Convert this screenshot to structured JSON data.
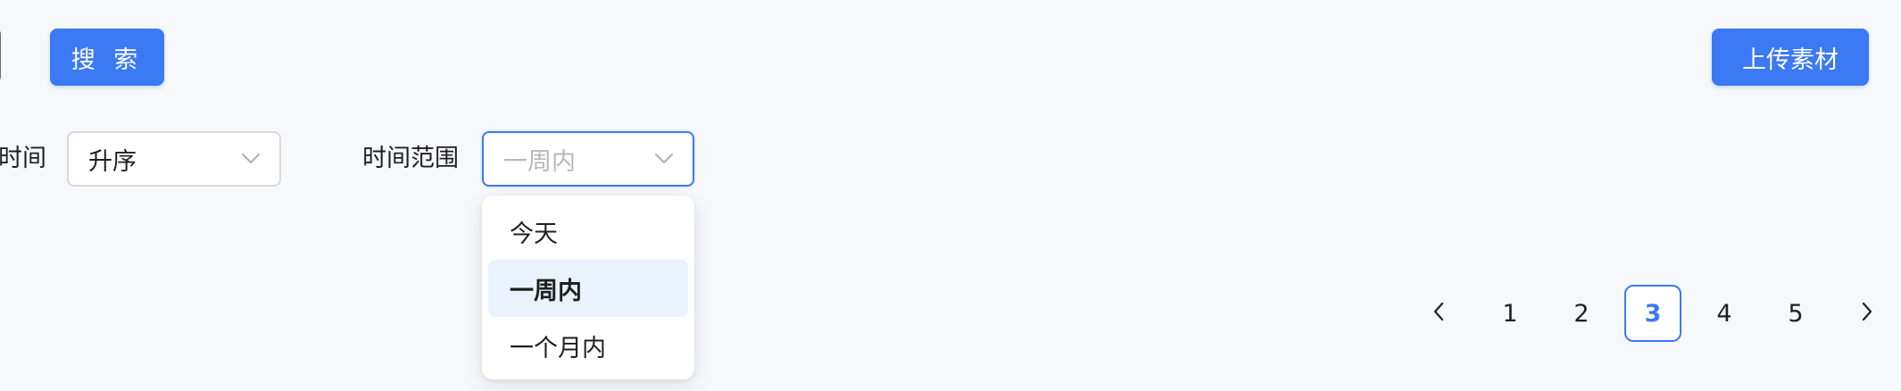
{
  "toolbar": {
    "search_label": "搜 索",
    "upload_label": "上传素材"
  },
  "filters": {
    "sort": {
      "label": "时间",
      "value": "升序"
    },
    "range": {
      "label": "时间范围",
      "placeholder": "一周内",
      "options": [
        "今天",
        "一周内",
        "一个月内"
      ],
      "active_index": 1
    }
  },
  "pagination": {
    "prev": "<",
    "next": ">",
    "pages": [
      "1",
      "2",
      "3",
      "4",
      "5"
    ],
    "current": "3"
  },
  "colors": {
    "accent": "#3b79f5",
    "background": "#f7f8fc",
    "option_highlight": "#e9f2fd",
    "placeholder_text": "#b8b8b8"
  },
  "icons": {
    "select_arrow": "chevron-down-icon",
    "prev": "chevron-left-icon",
    "next": "chevron-right-icon"
  }
}
